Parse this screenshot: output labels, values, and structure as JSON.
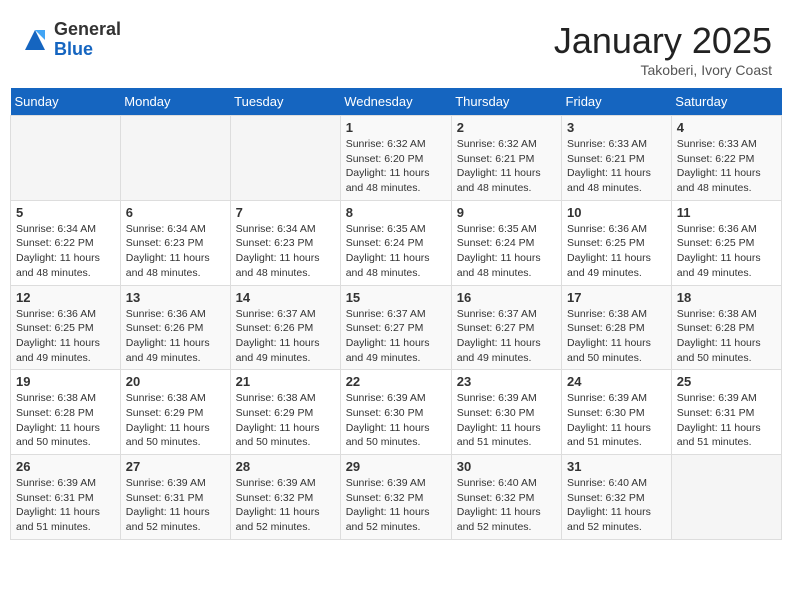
{
  "logo": {
    "general": "General",
    "blue": "Blue"
  },
  "header": {
    "month": "January 2025",
    "location": "Takoberi, Ivory Coast"
  },
  "weekdays": [
    "Sunday",
    "Monday",
    "Tuesday",
    "Wednesday",
    "Thursday",
    "Friday",
    "Saturday"
  ],
  "weeks": [
    [
      {
        "day": "",
        "info": ""
      },
      {
        "day": "",
        "info": ""
      },
      {
        "day": "",
        "info": ""
      },
      {
        "day": "1",
        "info": "Sunrise: 6:32 AM\nSunset: 6:20 PM\nDaylight: 11 hours and 48 minutes."
      },
      {
        "day": "2",
        "info": "Sunrise: 6:32 AM\nSunset: 6:21 PM\nDaylight: 11 hours and 48 minutes."
      },
      {
        "day": "3",
        "info": "Sunrise: 6:33 AM\nSunset: 6:21 PM\nDaylight: 11 hours and 48 minutes."
      },
      {
        "day": "4",
        "info": "Sunrise: 6:33 AM\nSunset: 6:22 PM\nDaylight: 11 hours and 48 minutes."
      }
    ],
    [
      {
        "day": "5",
        "info": "Sunrise: 6:34 AM\nSunset: 6:22 PM\nDaylight: 11 hours and 48 minutes."
      },
      {
        "day": "6",
        "info": "Sunrise: 6:34 AM\nSunset: 6:23 PM\nDaylight: 11 hours and 48 minutes."
      },
      {
        "day": "7",
        "info": "Sunrise: 6:34 AM\nSunset: 6:23 PM\nDaylight: 11 hours and 48 minutes."
      },
      {
        "day": "8",
        "info": "Sunrise: 6:35 AM\nSunset: 6:24 PM\nDaylight: 11 hours and 48 minutes."
      },
      {
        "day": "9",
        "info": "Sunrise: 6:35 AM\nSunset: 6:24 PM\nDaylight: 11 hours and 48 minutes."
      },
      {
        "day": "10",
        "info": "Sunrise: 6:36 AM\nSunset: 6:25 PM\nDaylight: 11 hours and 49 minutes."
      },
      {
        "day": "11",
        "info": "Sunrise: 6:36 AM\nSunset: 6:25 PM\nDaylight: 11 hours and 49 minutes."
      }
    ],
    [
      {
        "day": "12",
        "info": "Sunrise: 6:36 AM\nSunset: 6:25 PM\nDaylight: 11 hours and 49 minutes."
      },
      {
        "day": "13",
        "info": "Sunrise: 6:36 AM\nSunset: 6:26 PM\nDaylight: 11 hours and 49 minutes."
      },
      {
        "day": "14",
        "info": "Sunrise: 6:37 AM\nSunset: 6:26 PM\nDaylight: 11 hours and 49 minutes."
      },
      {
        "day": "15",
        "info": "Sunrise: 6:37 AM\nSunset: 6:27 PM\nDaylight: 11 hours and 49 minutes."
      },
      {
        "day": "16",
        "info": "Sunrise: 6:37 AM\nSunset: 6:27 PM\nDaylight: 11 hours and 49 minutes."
      },
      {
        "day": "17",
        "info": "Sunrise: 6:38 AM\nSunset: 6:28 PM\nDaylight: 11 hours and 50 minutes."
      },
      {
        "day": "18",
        "info": "Sunrise: 6:38 AM\nSunset: 6:28 PM\nDaylight: 11 hours and 50 minutes."
      }
    ],
    [
      {
        "day": "19",
        "info": "Sunrise: 6:38 AM\nSunset: 6:28 PM\nDaylight: 11 hours and 50 minutes."
      },
      {
        "day": "20",
        "info": "Sunrise: 6:38 AM\nSunset: 6:29 PM\nDaylight: 11 hours and 50 minutes."
      },
      {
        "day": "21",
        "info": "Sunrise: 6:38 AM\nSunset: 6:29 PM\nDaylight: 11 hours and 50 minutes."
      },
      {
        "day": "22",
        "info": "Sunrise: 6:39 AM\nSunset: 6:30 PM\nDaylight: 11 hours and 50 minutes."
      },
      {
        "day": "23",
        "info": "Sunrise: 6:39 AM\nSunset: 6:30 PM\nDaylight: 11 hours and 51 minutes."
      },
      {
        "day": "24",
        "info": "Sunrise: 6:39 AM\nSunset: 6:30 PM\nDaylight: 11 hours and 51 minutes."
      },
      {
        "day": "25",
        "info": "Sunrise: 6:39 AM\nSunset: 6:31 PM\nDaylight: 11 hours and 51 minutes."
      }
    ],
    [
      {
        "day": "26",
        "info": "Sunrise: 6:39 AM\nSunset: 6:31 PM\nDaylight: 11 hours and 51 minutes."
      },
      {
        "day": "27",
        "info": "Sunrise: 6:39 AM\nSunset: 6:31 PM\nDaylight: 11 hours and 52 minutes."
      },
      {
        "day": "28",
        "info": "Sunrise: 6:39 AM\nSunset: 6:32 PM\nDaylight: 11 hours and 52 minutes."
      },
      {
        "day": "29",
        "info": "Sunrise: 6:39 AM\nSunset: 6:32 PM\nDaylight: 11 hours and 52 minutes."
      },
      {
        "day": "30",
        "info": "Sunrise: 6:40 AM\nSunset: 6:32 PM\nDaylight: 11 hours and 52 minutes."
      },
      {
        "day": "31",
        "info": "Sunrise: 6:40 AM\nSunset: 6:32 PM\nDaylight: 11 hours and 52 minutes."
      },
      {
        "day": "",
        "info": ""
      }
    ]
  ]
}
